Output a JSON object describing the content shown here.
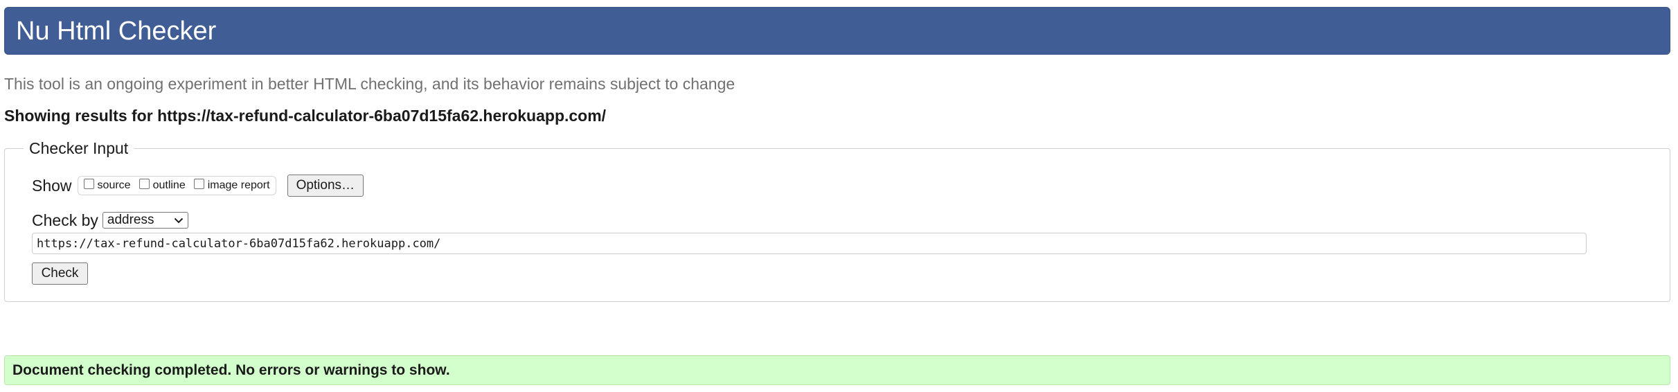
{
  "header": {
    "title": "Nu Html Checker"
  },
  "subtitle": "This tool is an ongoing experiment in better HTML checking, and its behavior remains subject to change",
  "results_heading": "Showing results for https://tax-refund-calculator-6ba07d15fa62.herokuapp.com/",
  "checker_input": {
    "legend": "Checker Input",
    "show_label": "Show",
    "options": [
      {
        "label": "source",
        "checked": false
      },
      {
        "label": "outline",
        "checked": false
      },
      {
        "label": "image report",
        "checked": false
      }
    ],
    "options_button": "Options…",
    "check_by_label": "Check by",
    "check_by_value": "address",
    "url_value": "https://tax-refund-calculator-6ba07d15fa62.herokuapp.com/",
    "check_button": "Check"
  },
  "status_message": "Document checking completed. No errors or warnings to show.",
  "colors": {
    "header_bg": "#415d95",
    "success_bg": "#d3ffcc"
  }
}
